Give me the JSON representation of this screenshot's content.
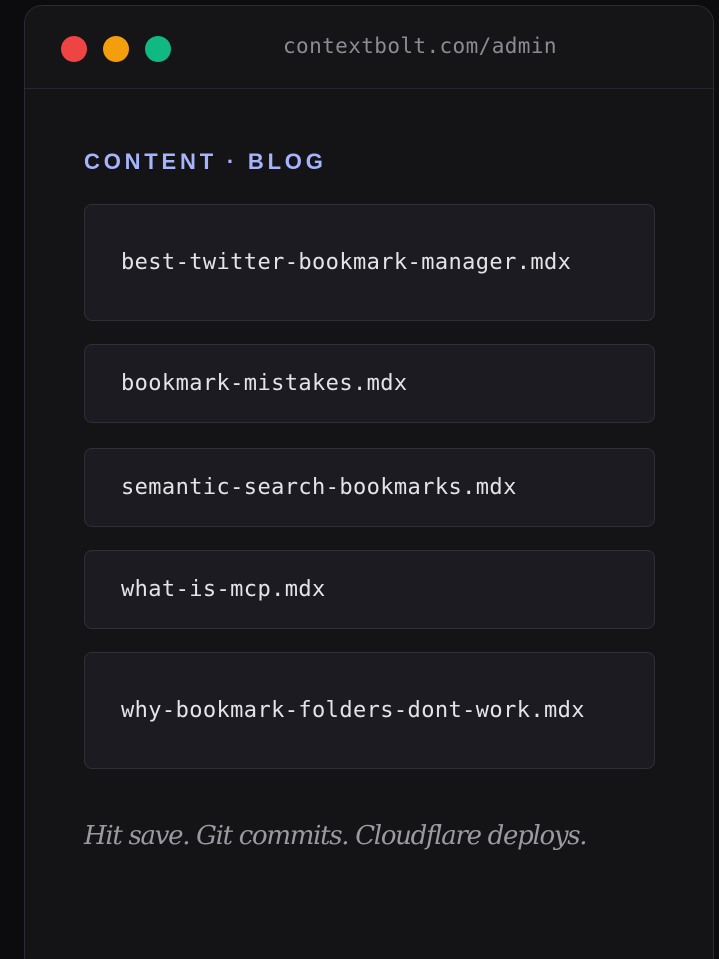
{
  "window": {
    "url": "contextbolt.com/admin",
    "traffic_lights": [
      "#ef4444",
      "#f59e0b",
      "#10b981"
    ]
  },
  "section": {
    "label": "CONTENT · BLOG"
  },
  "files": [
    {
      "name": "best-twitter-bookmark-manager.mdx"
    },
    {
      "name": "bookmark-mistakes.mdx"
    },
    {
      "name": "semantic-search-bookmarks.mdx"
    },
    {
      "name": "what-is-mcp.mdx"
    },
    {
      "name": "why-bookmark-folders-dont-work.mdx"
    }
  ],
  "tagline": "Hit save. Git commits. Cloudflare deploys.",
  "colors": {
    "accent": "#a5b4fc",
    "background": "#141417",
    "file_background": "#1b1b21"
  }
}
